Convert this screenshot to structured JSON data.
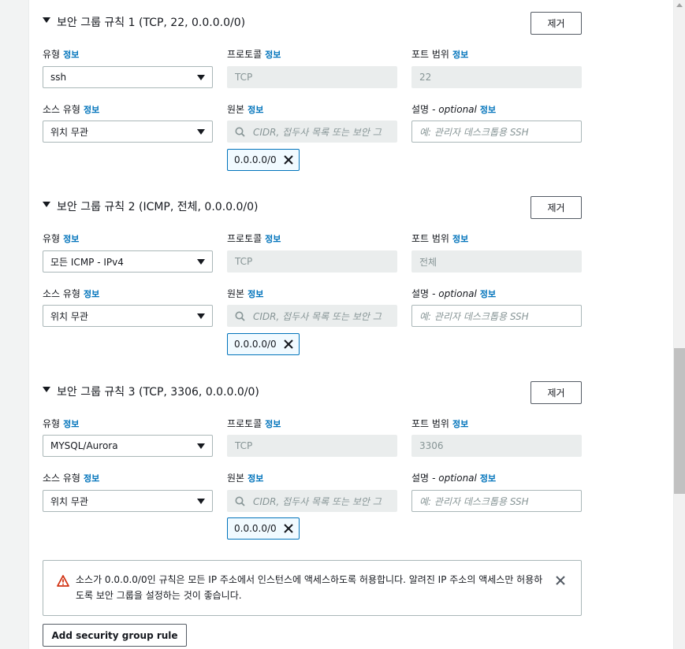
{
  "rules": [
    {
      "title": "보안 그룹 규칙 1 (TCP, 22, 0.0.0.0/0)",
      "remove_label": "제거",
      "type_label": "유형",
      "type_value": "ssh",
      "protocol_label": "프로토콜",
      "protocol_value": "TCP",
      "port_label": "포트 범위",
      "port_value": "22",
      "source_type_label": "소스 유형",
      "source_type_value": "위치 무관",
      "source_label": "원본",
      "source_placeholder": "CIDR, 접두사 목록 또는 보안 그",
      "token": "0.0.0.0/0",
      "desc_label": "설명",
      "desc_optional": "- optional",
      "desc_placeholder": "예: 관리자 데스크톱용 SSH"
    },
    {
      "title": "보안 그룹 규칙 2 (ICMP, 전체, 0.0.0.0/0)",
      "remove_label": "제거",
      "type_label": "유형",
      "type_value": "모든 ICMP - IPv4",
      "protocol_label": "프로토콜",
      "protocol_value": "TCP",
      "port_label": "포트 범위",
      "port_value": "전체",
      "source_type_label": "소스 유형",
      "source_type_value": "위치 무관",
      "source_label": "원본",
      "source_placeholder": "CIDR, 접두사 목록 또는 보안 그",
      "token": "0.0.0.0/0",
      "desc_label": "설명",
      "desc_optional": "- optional",
      "desc_placeholder": "예: 관리자 데스크톱용 SSH"
    },
    {
      "title": "보안 그룹 규칙 3 (TCP, 3306, 0.0.0.0/0)",
      "remove_label": "제거",
      "type_label": "유형",
      "type_value": "MYSQL/Aurora",
      "protocol_label": "프로토콜",
      "protocol_value": "TCP",
      "port_label": "포트 범위",
      "port_value": "3306",
      "source_type_label": "소스 유형",
      "source_type_value": "위치 무관",
      "source_label": "원본",
      "source_placeholder": "CIDR, 접두사 목록 또는 보안 그",
      "token": "0.0.0.0/0",
      "desc_label": "설명",
      "desc_optional": "- optional",
      "desc_placeholder": "예: 관리자 데스크톱용 SSH"
    }
  ],
  "info_label": "정보",
  "alert": {
    "text": "소스가 0.0.0.0/0인 규칙은 모든 IP 주소에서 인스턴스에 액세스하도록 허용합니다. 알려진 IP 주소의 액세스만 허용하도록 보안 그룹을 설정하는 것이 좋습니다.",
    "icon": "warning-icon"
  },
  "add_rule_label": "Add security group rule",
  "colors": {
    "link": "#0073bb",
    "warning": "#d13212",
    "disabled_bg": "#eaeded",
    "token_border": "#0073bb"
  }
}
